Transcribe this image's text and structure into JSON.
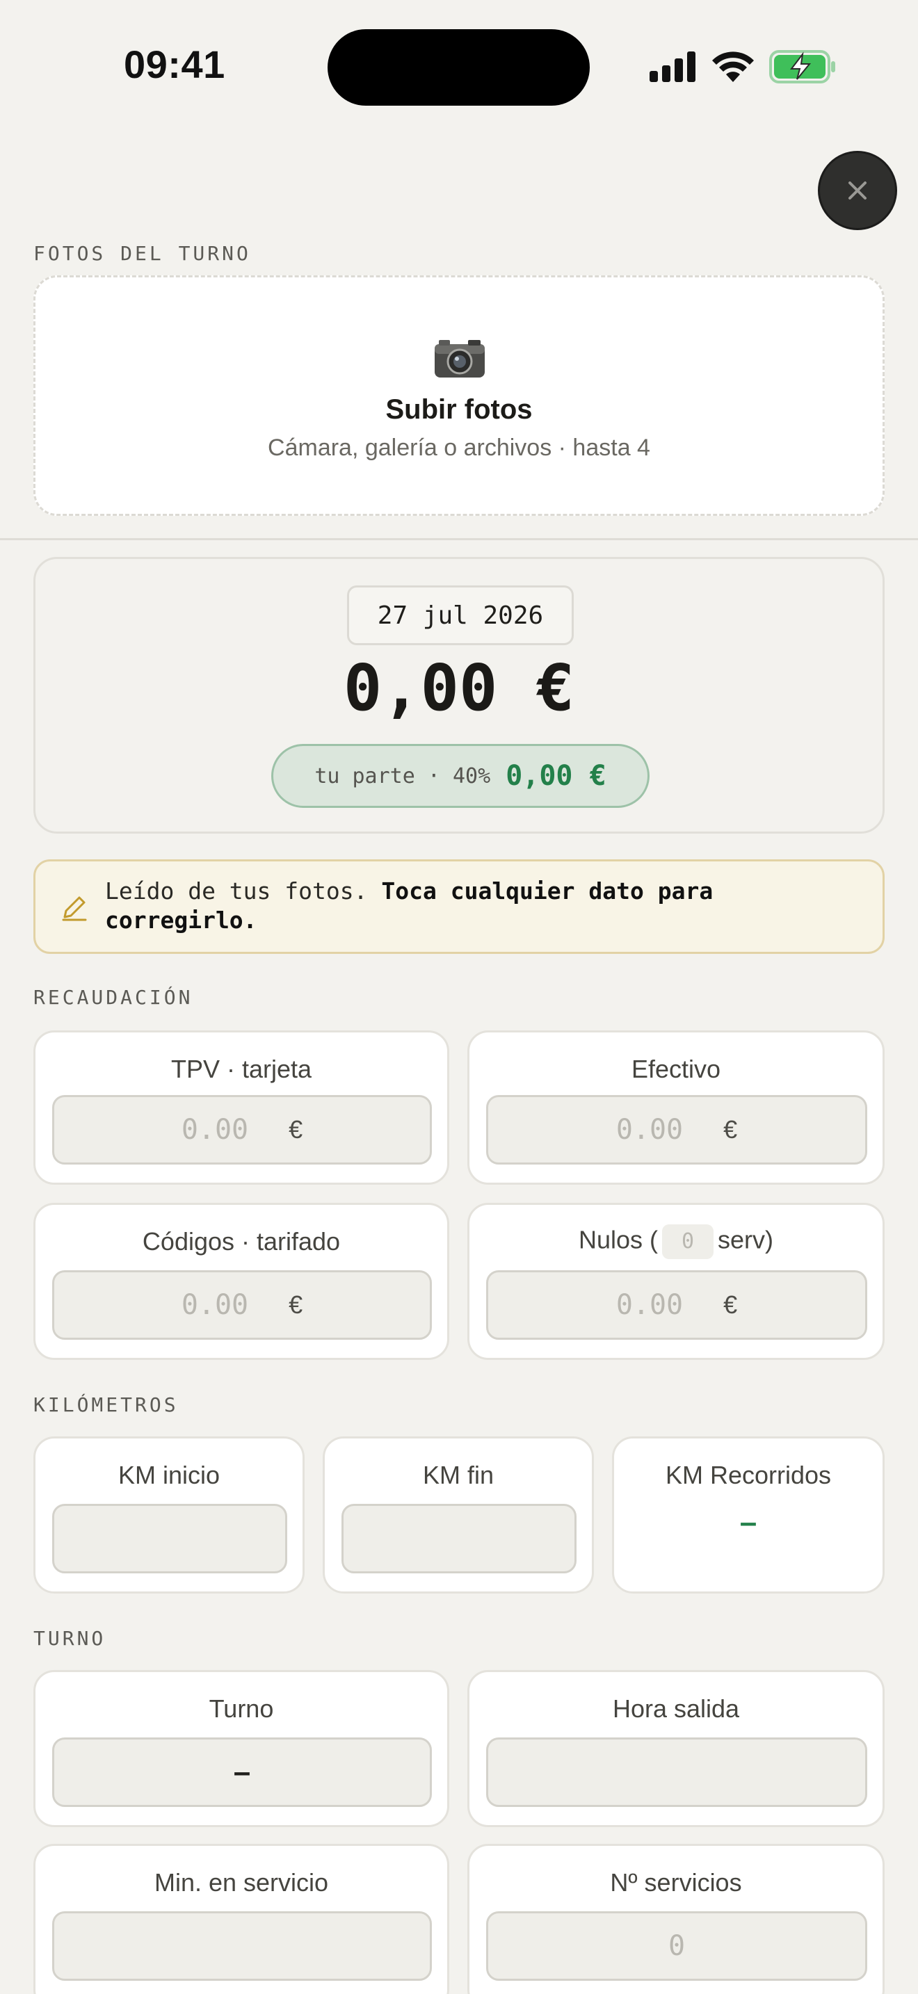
{
  "status_bar": {
    "time": "09:41"
  },
  "close_button_icon": "close-icon",
  "photos": {
    "section_title": "FOTOS DEL TURNO",
    "upload_title": "Subir fotos",
    "upload_subtitle": "Cámara, galería o archivos · hasta 4",
    "icon": "camera-icon"
  },
  "summary": {
    "date": "27 jul 2026",
    "total": "0,00 €",
    "share_label": "tu parte · 40%",
    "share_value": "0,00 €"
  },
  "notice": {
    "text": "Leído de tus fotos.",
    "bold": "Toca cualquier dato para corregirlo."
  },
  "recaudacion": {
    "section_title": "RECAUDACIÓN",
    "fields": [
      {
        "label": "TPV · tarjeta",
        "placeholder": "0.00",
        "unit": "€"
      },
      {
        "label": "Efectivo",
        "placeholder": "0.00",
        "unit": "€"
      },
      {
        "label": "Códigos · tarifado",
        "placeholder": "0.00",
        "unit": "€"
      },
      {
        "label_prefix": "Nulos (",
        "label_input": "0",
        "label_suffix": "serv)",
        "placeholder": "0.00",
        "unit": "€"
      }
    ]
  },
  "kilometros": {
    "section_title": "KILÓMETROS",
    "fields": [
      {
        "label": "KM inicio",
        "value": ""
      },
      {
        "label": "KM fin",
        "value": ""
      },
      {
        "label": "KM Recorridos",
        "value": "–"
      }
    ]
  },
  "turno": {
    "section_title": "TURNO",
    "fields": [
      {
        "label": "Turno",
        "value": "–"
      },
      {
        "label": "Hora salida",
        "value": ""
      },
      {
        "label": "Min. en servicio",
        "value": ""
      },
      {
        "label": "Nº servicios",
        "placeholder": "0"
      }
    ]
  },
  "colors": {
    "accent_green": "#23804a",
    "notice_border": "#e2d2a5",
    "background": "#f3f2ee"
  }
}
